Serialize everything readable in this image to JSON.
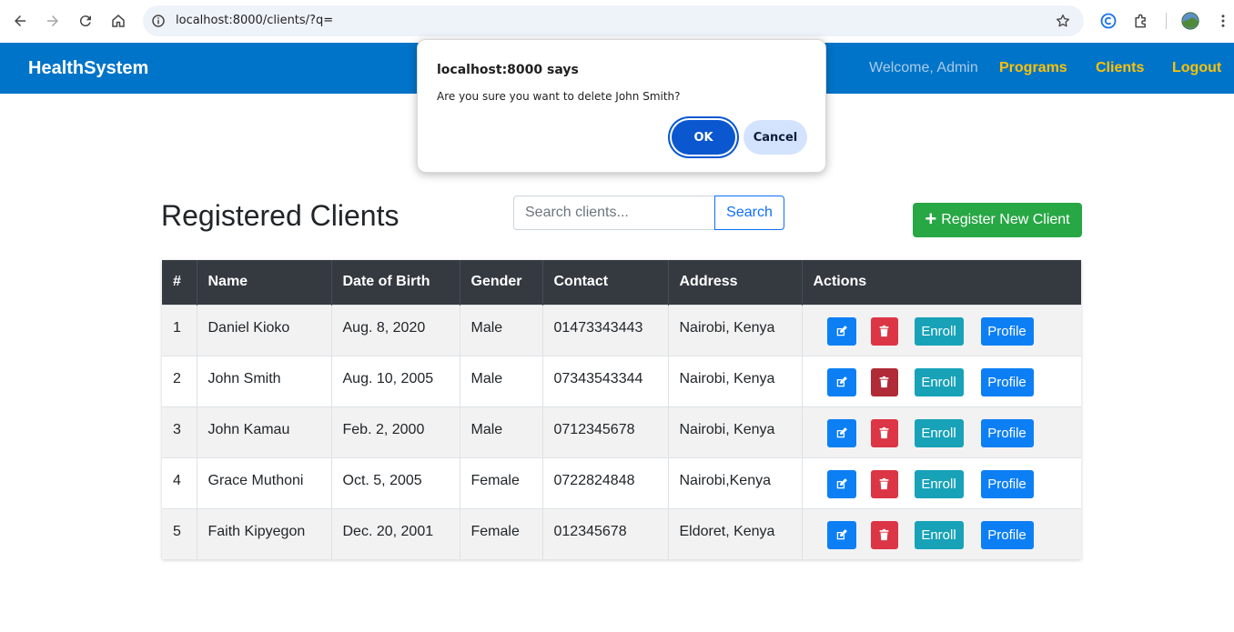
{
  "browser": {
    "url": "localhost:8000/clients/?q="
  },
  "navbar": {
    "brand": "HealthSystem",
    "welcome": "Welcome, Admin",
    "links": [
      {
        "label": "Programs"
      },
      {
        "label": "Clients"
      },
      {
        "label": "Logout"
      }
    ]
  },
  "page": {
    "title": "Registered Clients",
    "search": {
      "placeholder": "Search clients...",
      "value": "",
      "button": "Search"
    },
    "register_button": "Register New Client"
  },
  "table": {
    "headers": [
      "#",
      "Name",
      "Date of Birth",
      "Gender",
      "Contact",
      "Address",
      "Actions"
    ],
    "rows": [
      {
        "num": "1",
        "name": "Daniel Kioko",
        "dob": "Aug. 8, 2020",
        "gender": "Male",
        "contact": "01473343443",
        "address": "Nairobi, Kenya"
      },
      {
        "num": "2",
        "name": "John Smith",
        "dob": "Aug. 10, 2005",
        "gender": "Male",
        "contact": "07343543344",
        "address": "Nairobi, Kenya"
      },
      {
        "num": "3",
        "name": "John Kamau",
        "dob": "Feb. 2, 2000",
        "gender": "Male",
        "contact": "0712345678",
        "address": "Nairobi, Kenya"
      },
      {
        "num": "4",
        "name": "Grace Muthoni",
        "dob": "Oct. 5, 2005",
        "gender": "Female",
        "contact": "0722824848",
        "address": "Nairobi,Kenya"
      },
      {
        "num": "5",
        "name": "Faith Kipyegon",
        "dob": "Dec. 20, 2001",
        "gender": "Female",
        "contact": "012345678",
        "address": "Eldoret, Kenya"
      }
    ],
    "action_labels": {
      "enroll": "Enroll",
      "profile": "Profile"
    }
  },
  "dialog": {
    "title": "localhost:8000 says",
    "message": "Are you sure you want to delete John Smith?",
    "ok": "OK",
    "cancel": "Cancel"
  },
  "colors": {
    "navbar": "#0074c8",
    "nav_link": "#ffc107",
    "header_row": "#343a40",
    "register": "#28a745",
    "edit": "#0d7ff5",
    "delete": "#dc3545",
    "enroll": "#17a2b8",
    "dialog_ok": "#0b57d0"
  },
  "icons": {
    "back": "arrow-left-icon",
    "forward": "arrow-right-icon",
    "reload": "reload-icon",
    "home": "home-icon",
    "site_info": "info-icon",
    "bookmark": "star-icon",
    "extension": "puzzle-icon",
    "edit": "edit-icon",
    "delete": "trash-icon"
  }
}
